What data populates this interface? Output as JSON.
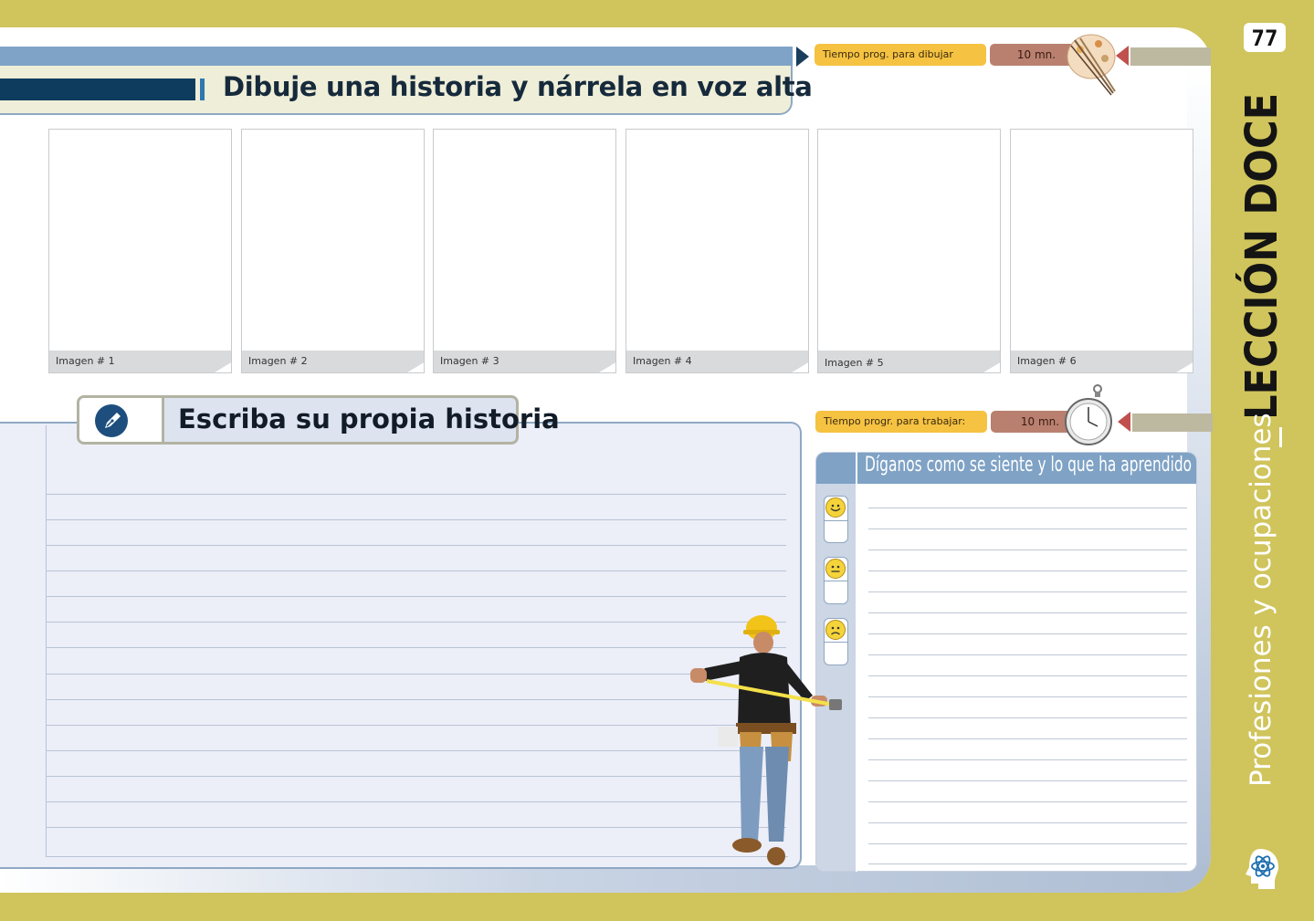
{
  "page_number": "77",
  "header": {
    "title": "Dibuje una historia y nárrela en voz alta",
    "timer_label": "Tiempo prog. para dibujar",
    "timer_value": "10 mn."
  },
  "images": [
    {
      "label": "Imagen # 1"
    },
    {
      "label": "Imagen # 2"
    },
    {
      "label": "Imagen # 3"
    },
    {
      "label": "Imagen # 4"
    },
    {
      "label": "Imagen # 5"
    },
    {
      "label": "Imagen # 6"
    }
  ],
  "story": {
    "title": "Escriba su propia historia"
  },
  "work_timer": {
    "label": "Tiempo progr. para trabajar:",
    "value": "10 mn."
  },
  "feelings": {
    "title": "Díganos como se siente y lo que ha aprendido",
    "faces": [
      "happy-face-icon",
      "neutral-face-icon",
      "sad-face-icon"
    ]
  },
  "side": {
    "lesson": "LECCIÓN DOCE",
    "topic": "Profesiones y ocupaciones"
  },
  "colors": {
    "background": "#d0c45c",
    "header_dark": "#0e3c5e",
    "header_stripe": "#7fa3c6",
    "timer_label": "#f5c242",
    "timer_value": "#b98070"
  }
}
